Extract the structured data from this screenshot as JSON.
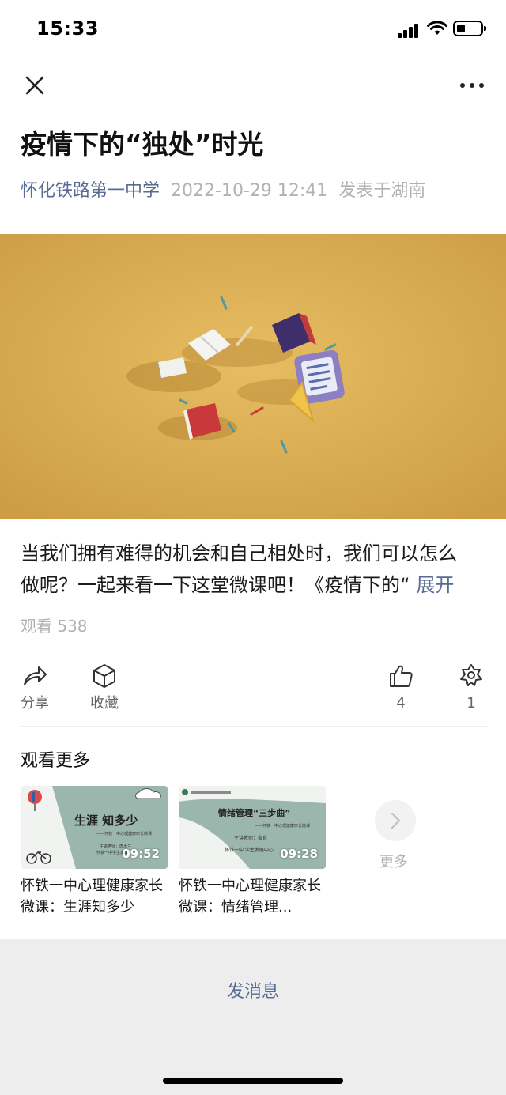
{
  "status_bar": {
    "time": "15:33"
  },
  "article": {
    "title": "疫情下的“独处”时光",
    "author": "怀化铁路第一中学",
    "date": "2022-10-29 12:41",
    "location": "发表于湖南",
    "description_line1": "当我们拥有难得的机会和自己相处时，我们可以怎么",
    "description_line2": "做呢？一起来看一下这堂微课吧！《疫情下的“",
    "expand_label": "展开",
    "views": "观看 538"
  },
  "actions": {
    "share_label": "分享",
    "collect_label": "收藏",
    "like_count": "4",
    "wow_count": "1"
  },
  "more_section": {
    "title": "观看更多",
    "videos": [
      {
        "thumb_title": "生涯 知多少",
        "thumb_sub": "——怀铁一中心理健康家长微课",
        "thumb_teacher": "主讲老师：唐木兰",
        "thumb_org": "怀铁一中学生发展中心",
        "duration": "09:52",
        "title": "怀铁一中心理健康家长微课：生涯知多少"
      },
      {
        "thumb_title": "情绪管理“三步曲”",
        "thumb_sub": "——怀铁一中心理健康家长微课",
        "thumb_teacher": "主讲教师：黎良",
        "thumb_org": "怀铁一中 学生发展中心",
        "duration": "09:28",
        "title": "怀铁一中心理健康家长微课：情绪管理..."
      }
    ],
    "more_label": "更多"
  },
  "bottom": {
    "message_button": "发消息"
  },
  "colors": {
    "link": "#576b95",
    "secondary_text": "#b2b2b2",
    "video_background": "#d9aa4e",
    "bottom_bar": "#ededed"
  }
}
